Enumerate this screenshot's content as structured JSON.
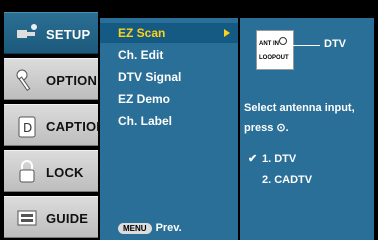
{
  "tabs": [
    {
      "label": "SETUP",
      "icon": "satellite-icon",
      "active": true
    },
    {
      "label": "OPTION",
      "icon": "wrench-icon",
      "active": false
    },
    {
      "label": "CAPTION",
      "icon": "caption-icon",
      "active": false
    },
    {
      "label": "LOCK",
      "icon": "lock-icon",
      "active": false
    },
    {
      "label": "GUIDE",
      "icon": "guide-icon",
      "active": false
    }
  ],
  "menu": {
    "items": [
      "EZ Scan",
      "Ch. Edit",
      "DTV Signal",
      "EZ Demo",
      "Ch. Label"
    ],
    "selected_index": 0,
    "prev_key": "MENU",
    "prev_label": "Prev."
  },
  "info": {
    "antenna_card_line1": "ANT IN",
    "antenna_card_line2": "LOOPOUT",
    "dtv_label": "DTV",
    "instruction": "Select antenna input, press ⊙.",
    "options": [
      "1. DTV",
      "2. CADTV"
    ],
    "checked_index": 0
  },
  "colors": {
    "accent_selected": "#ffd21a",
    "panel_blue": "#2a6f97"
  }
}
